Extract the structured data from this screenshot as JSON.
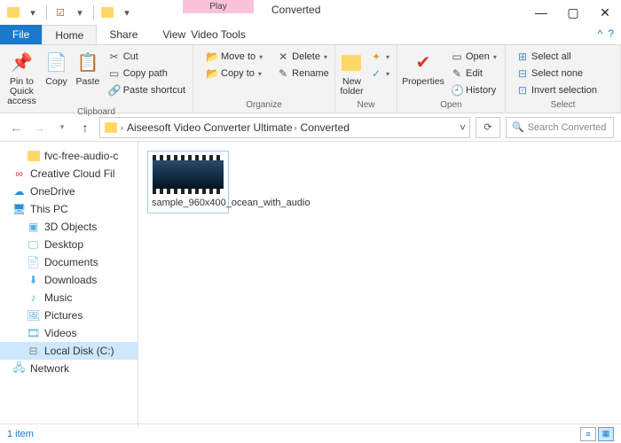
{
  "window": {
    "title": "Converted",
    "context_tab_top": "Play",
    "context_tab": "Video Tools"
  },
  "tabs": {
    "file": "File",
    "home": "Home",
    "share": "Share",
    "view": "View"
  },
  "ribbon": {
    "clipboard": {
      "label": "Clipboard",
      "pin": "Pin to Quick access",
      "copy": "Copy",
      "paste": "Paste",
      "cut": "Cut",
      "copy_path": "Copy path",
      "paste_shortcut": "Paste shortcut"
    },
    "organize": {
      "label": "Organize",
      "move_to": "Move to",
      "copy_to": "Copy to",
      "delete": "Delete",
      "rename": "Rename"
    },
    "new_group": {
      "label": "New",
      "new_folder": "New folder"
    },
    "open_group": {
      "label": "Open",
      "properties": "Properties",
      "open": "Open",
      "edit": "Edit",
      "history": "History"
    },
    "select_group": {
      "label": "Select",
      "all": "Select all",
      "none": "Select none",
      "invert": "Invert selection"
    }
  },
  "address": {
    "segments": [
      "Aiseesoft Video Converter Ultimate",
      "Converted"
    ],
    "search_placeholder": "Search Converted"
  },
  "tree": {
    "items": [
      {
        "label": "fvc-free-audio-c",
        "indent": "sub",
        "icon": "folder"
      },
      {
        "label": "Creative Cloud Fil",
        "indent": "root",
        "icon": "cc"
      },
      {
        "label": "OneDrive",
        "indent": "root",
        "icon": "cloud"
      },
      {
        "label": "This PC",
        "indent": "root",
        "icon": "pc"
      },
      {
        "label": "3D Objects",
        "indent": "sub",
        "icon": "cube"
      },
      {
        "label": "Desktop",
        "indent": "sub",
        "icon": "desktop"
      },
      {
        "label": "Documents",
        "indent": "sub",
        "icon": "doc"
      },
      {
        "label": "Downloads",
        "indent": "sub",
        "icon": "down"
      },
      {
        "label": "Music",
        "indent": "sub",
        "icon": "music"
      },
      {
        "label": "Pictures",
        "indent": "sub",
        "icon": "pic"
      },
      {
        "label": "Videos",
        "indent": "sub",
        "icon": "video"
      },
      {
        "label": "Local Disk (C:)",
        "indent": "sub",
        "icon": "disk",
        "selected": true
      },
      {
        "label": "Network",
        "indent": "root",
        "icon": "net"
      }
    ]
  },
  "files": [
    {
      "name": "sample_960x400_ocean_with_audio"
    }
  ],
  "status": {
    "count": "1 item"
  }
}
